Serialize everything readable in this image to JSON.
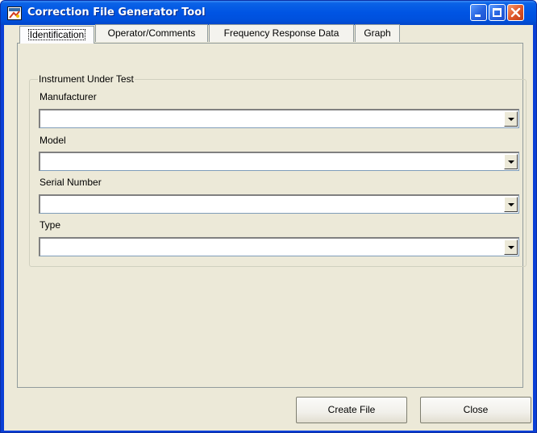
{
  "window": {
    "title": "Correction File Generator Tool",
    "app_icon": "tool-icon",
    "title_buttons": [
      "minimize-icon",
      "maximize-icon",
      "close-icon"
    ],
    "colors": {
      "titlebar": "#0054e3",
      "client": "#ece9d8",
      "close_button": "#e0582b"
    }
  },
  "tabs": [
    {
      "label": "Identification",
      "active": true
    },
    {
      "label": "Operator/Comments",
      "active": false
    },
    {
      "label": "Frequency Response Data",
      "active": false
    },
    {
      "label": "Graph",
      "active": false
    }
  ],
  "identification": {
    "group_title": "Instrument Under Test",
    "fields": [
      {
        "label": "Manufacturer",
        "value": ""
      },
      {
        "label": "Model",
        "value": ""
      },
      {
        "label": "Serial Number",
        "value": ""
      },
      {
        "label": "Type",
        "value": ""
      }
    ]
  },
  "buttons": {
    "create_file": "Create File",
    "close": "Close"
  }
}
